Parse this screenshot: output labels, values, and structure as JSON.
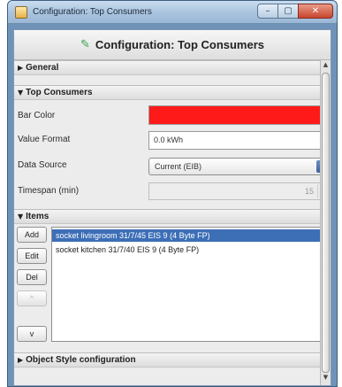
{
  "window": {
    "title": "Configuration: Top Consumers",
    "buttons": {
      "minimize": "–",
      "maximize": "▢",
      "close": "✕"
    }
  },
  "header": {
    "icon": "edit-icon",
    "title": "Configuration: Top Consumers"
  },
  "sections": {
    "general": {
      "label": "General",
      "expanded": false
    },
    "top_consumers": {
      "label": "Top Consumers",
      "expanded": true
    },
    "items": {
      "label": "Items",
      "expanded": true
    },
    "object_style": {
      "label": "Object Style configuration",
      "expanded": false
    }
  },
  "fields": {
    "bar_color": {
      "label": "Bar Color",
      "value": "#ff1a1a"
    },
    "value_format": {
      "label": "Value Format",
      "value": "0.0 kWh"
    },
    "data_source": {
      "label": "Data Source",
      "value": "Current (EIB)"
    },
    "timespan": {
      "label": "Timespan (min)",
      "value": "15"
    }
  },
  "item_buttons": {
    "add": "Add",
    "edit": "Edit",
    "del": "Del",
    "up": "^",
    "down": "v"
  },
  "items_list": [
    {
      "label": "socket livingroom 31/7/45 EIS 9 (4 Byte FP)",
      "selected": true
    },
    {
      "label": "socket kitchen 31/7/40 EIS 9 (4 Byte FP)",
      "selected": false
    }
  ]
}
